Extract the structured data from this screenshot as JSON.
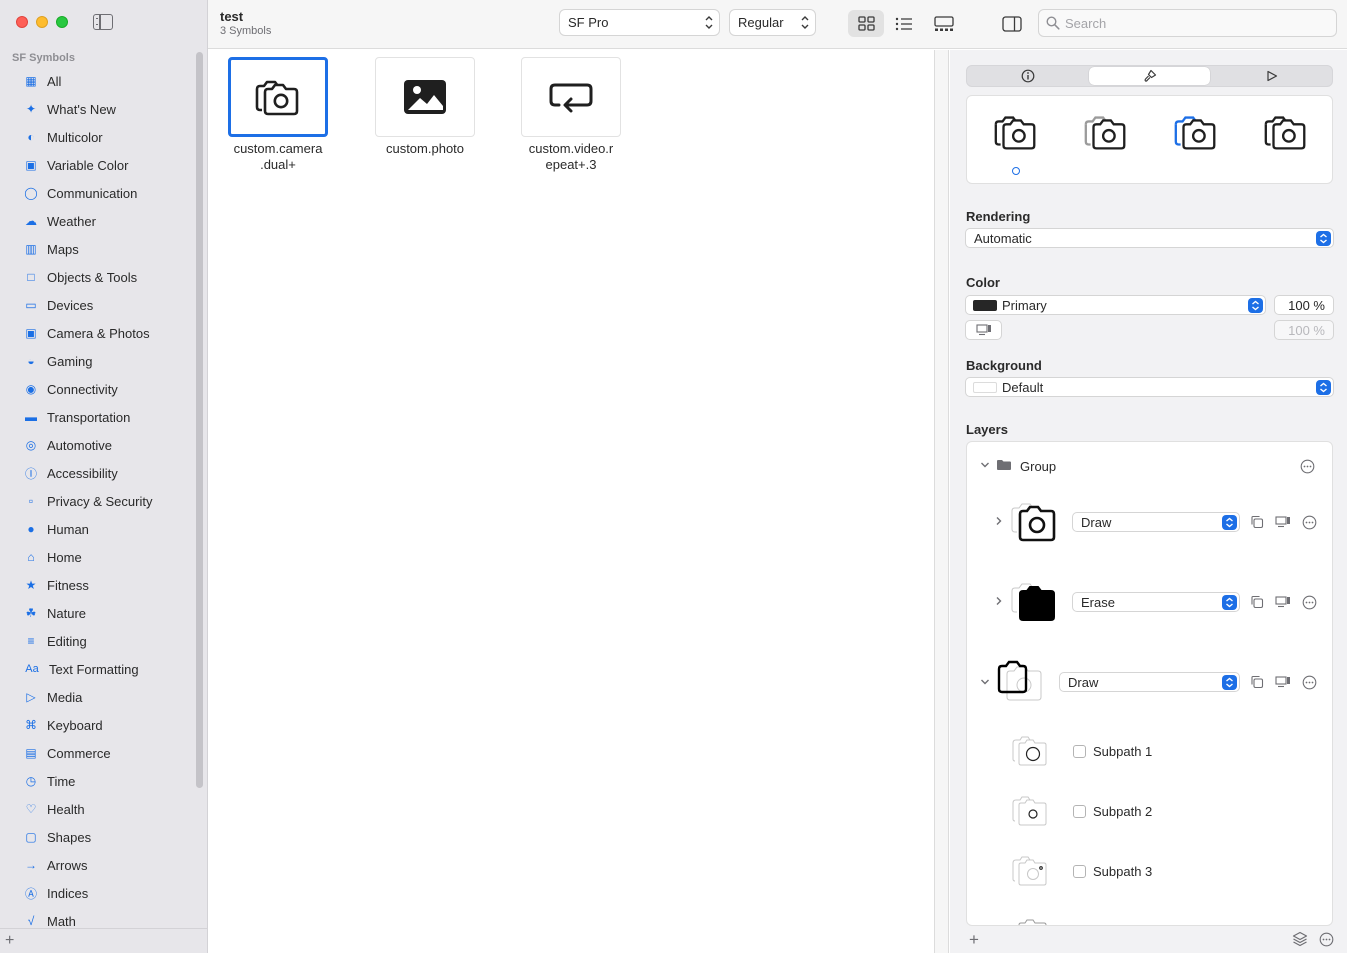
{
  "window": {
    "sidebar_section": "SF Symbols",
    "document_title": "test",
    "document_subtitle": "3 Symbols"
  },
  "sidebar": {
    "items": [
      {
        "label": "All",
        "icon": "grid-icon"
      },
      {
        "label": "What's New",
        "icon": "sparkle-icon"
      },
      {
        "label": "Multicolor",
        "icon": "palette-icon"
      },
      {
        "label": "Variable Color",
        "icon": "variable-color-icon"
      },
      {
        "label": "Communication",
        "icon": "speech-bubble-icon"
      },
      {
        "label": "Weather",
        "icon": "cloud-sun-icon"
      },
      {
        "label": "Maps",
        "icon": "map-icon"
      },
      {
        "label": "Objects & Tools",
        "icon": "folder-icon"
      },
      {
        "label": "Devices",
        "icon": "display-icon"
      },
      {
        "label": "Camera & Photos",
        "icon": "camera-icon"
      },
      {
        "label": "Gaming",
        "icon": "gamecontroller-icon"
      },
      {
        "label": "Connectivity",
        "icon": "antenna-icon"
      },
      {
        "label": "Transportation",
        "icon": "car-icon"
      },
      {
        "label": "Automotive",
        "icon": "steering-wheel-icon"
      },
      {
        "label": "Accessibility",
        "icon": "accessibility-icon"
      },
      {
        "label": "Privacy & Security",
        "icon": "lock-icon"
      },
      {
        "label": "Human",
        "icon": "person-icon"
      },
      {
        "label": "Home",
        "icon": "house-icon"
      },
      {
        "label": "Fitness",
        "icon": "figure-run-icon"
      },
      {
        "label": "Nature",
        "icon": "leaf-icon"
      },
      {
        "label": "Editing",
        "icon": "slider-icon"
      },
      {
        "label": "Text Formatting",
        "icon": "textformat-icon"
      },
      {
        "label": "Media",
        "icon": "playpause-icon"
      },
      {
        "label": "Keyboard",
        "icon": "command-icon"
      },
      {
        "label": "Commerce",
        "icon": "cart-icon"
      },
      {
        "label": "Time",
        "icon": "clock-icon"
      },
      {
        "label": "Health",
        "icon": "heart-icon"
      },
      {
        "label": "Shapes",
        "icon": "shapes-icon"
      },
      {
        "label": "Arrows",
        "icon": "arrow-right-icon"
      },
      {
        "label": "Indices",
        "icon": "a-circle-icon"
      },
      {
        "label": "Math",
        "icon": "sqrt-icon"
      }
    ]
  },
  "toolbar": {
    "font_popup": "SF Pro",
    "weight_popup": "Regular",
    "search_placeholder": "Search"
  },
  "symbols": [
    {
      "name_line1": "custom.camera",
      "name_line2": ".dual+",
      "selected": true
    },
    {
      "name_line1": "custom.photo",
      "name_line2": "",
      "selected": false
    },
    {
      "name_line1": "custom.video.r",
      "name_line2": "epeat+.3",
      "selected": false
    }
  ],
  "inspector": {
    "rendering_heading": "Rendering",
    "rendering_value": "Automatic",
    "color_heading": "Color",
    "color_value": "Primary",
    "color_swatch": "#262626",
    "color_opacity": "100 %",
    "secondary_opacity": "100 %",
    "background_heading": "Background",
    "background_value": "Default",
    "layers_heading": "Layers",
    "layers": {
      "group_label": "Group",
      "layer1_mode": "Draw",
      "layer2_mode": "Erase",
      "layer3_mode": "Draw",
      "subpaths": [
        "Subpath 1",
        "Subpath 2",
        "Subpath 3"
      ]
    }
  },
  "colors": {
    "accent": "#1d6fe6",
    "sidebar_bg": "#e7e6ea"
  }
}
